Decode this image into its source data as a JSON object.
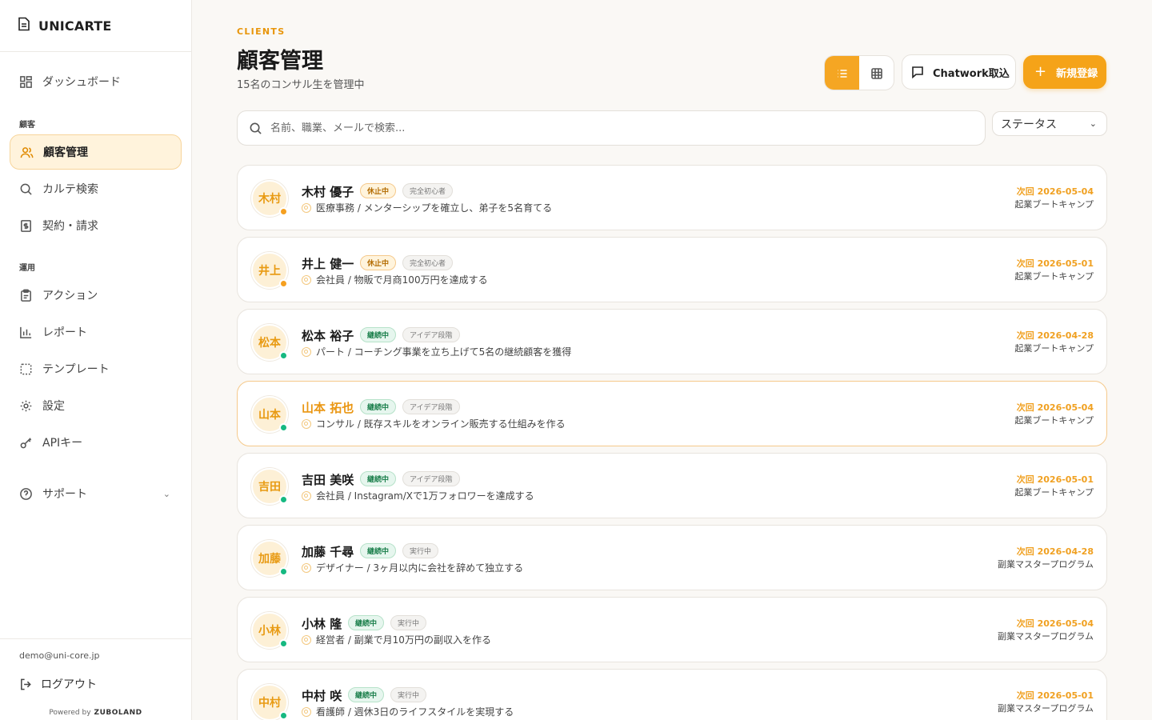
{
  "app": {
    "name": "UNICARTE"
  },
  "sidebar": {
    "dashboard": "ダッシュボード",
    "section_clients": "顧客",
    "clients": "顧客管理",
    "karte_search": "カルテ検索",
    "contract_billing": "契約・請求",
    "section_ops": "運用",
    "actions": "アクション",
    "reports": "レポート",
    "templates": "テンプレート",
    "settings": "設定",
    "api_keys": "APIキー",
    "support": "サポート"
  },
  "footer": {
    "email": "demo@uni-core.jp",
    "logout": "ログアウト",
    "powered_by": "Powered by",
    "powered_brand": "ZUBOLAND"
  },
  "header": {
    "kicker": "CLIENTS",
    "title": "顧客管理",
    "subtitle": "15名のコンサル生を管理中",
    "chatwork_label": "Chatwork取込",
    "new_label": "新規登録",
    "active_view": "list"
  },
  "search": {
    "placeholder": "名前、職業、メールで検索...",
    "value": ""
  },
  "filter": {
    "status_label": "ステータス"
  },
  "colors": {
    "accent": "#f5a318",
    "status_pause": "#f5a020",
    "status_cont": "#16b981"
  },
  "clients": [
    {
      "avatar": "木村",
      "name": "木村 優子",
      "status": "休止中",
      "stage": "完全初心者",
      "desc": "医療事務 / メンターシップを確立し、弟子を5名育てる",
      "next": "次回 2026-05-04",
      "program": "起業ブートキャンプ"
    },
    {
      "avatar": "井上",
      "name": "井上 健一",
      "status": "休止中",
      "stage": "完全初心者",
      "desc": "会社員 / 物販で月商100万円を達成する",
      "next": "次回 2026-05-01",
      "program": "起業ブートキャンプ"
    },
    {
      "avatar": "松本",
      "name": "松本 裕子",
      "status": "継続中",
      "stage": "アイデア段階",
      "desc": "パート / コーチング事業を立ち上げて5名の継続顧客を獲得",
      "next": "次回 2026-04-28",
      "program": "起業ブートキャンプ"
    },
    {
      "avatar": "山本",
      "name": "山本 拓也",
      "status": "継続中",
      "stage": "アイデア段階",
      "desc": "コンサル / 既存スキルをオンライン販売する仕組みを作る",
      "next": "次回 2026-05-04",
      "program": "起業ブートキャンプ"
    },
    {
      "avatar": "吉田",
      "name": "吉田 美咲",
      "status": "継続中",
      "stage": "アイデア段階",
      "desc": "会社員 / Instagram/Xで1万フォロワーを達成する",
      "next": "次回 2026-05-01",
      "program": "起業ブートキャンプ"
    },
    {
      "avatar": "加藤",
      "name": "加藤 千尋",
      "status": "継続中",
      "stage": "実行中",
      "desc": "デザイナー / 3ヶ月以内に会社を辞めて独立する",
      "next": "次回 2026-04-28",
      "program": "副業マスタープログラム"
    },
    {
      "avatar": "小林",
      "name": "小林 隆",
      "status": "継続中",
      "stage": "実行中",
      "desc": "経営者 / 副業で月10万円の副収入を作る",
      "next": "次回 2026-05-04",
      "program": "副業マスタープログラム"
    },
    {
      "avatar": "中村",
      "name": "中村 咲",
      "status": "継続中",
      "stage": "実行中",
      "desc": "看護師 / 週休3日のライフスタイルを実現する",
      "next": "次回 2026-05-01",
      "program": "副業マスタープログラム"
    }
  ]
}
